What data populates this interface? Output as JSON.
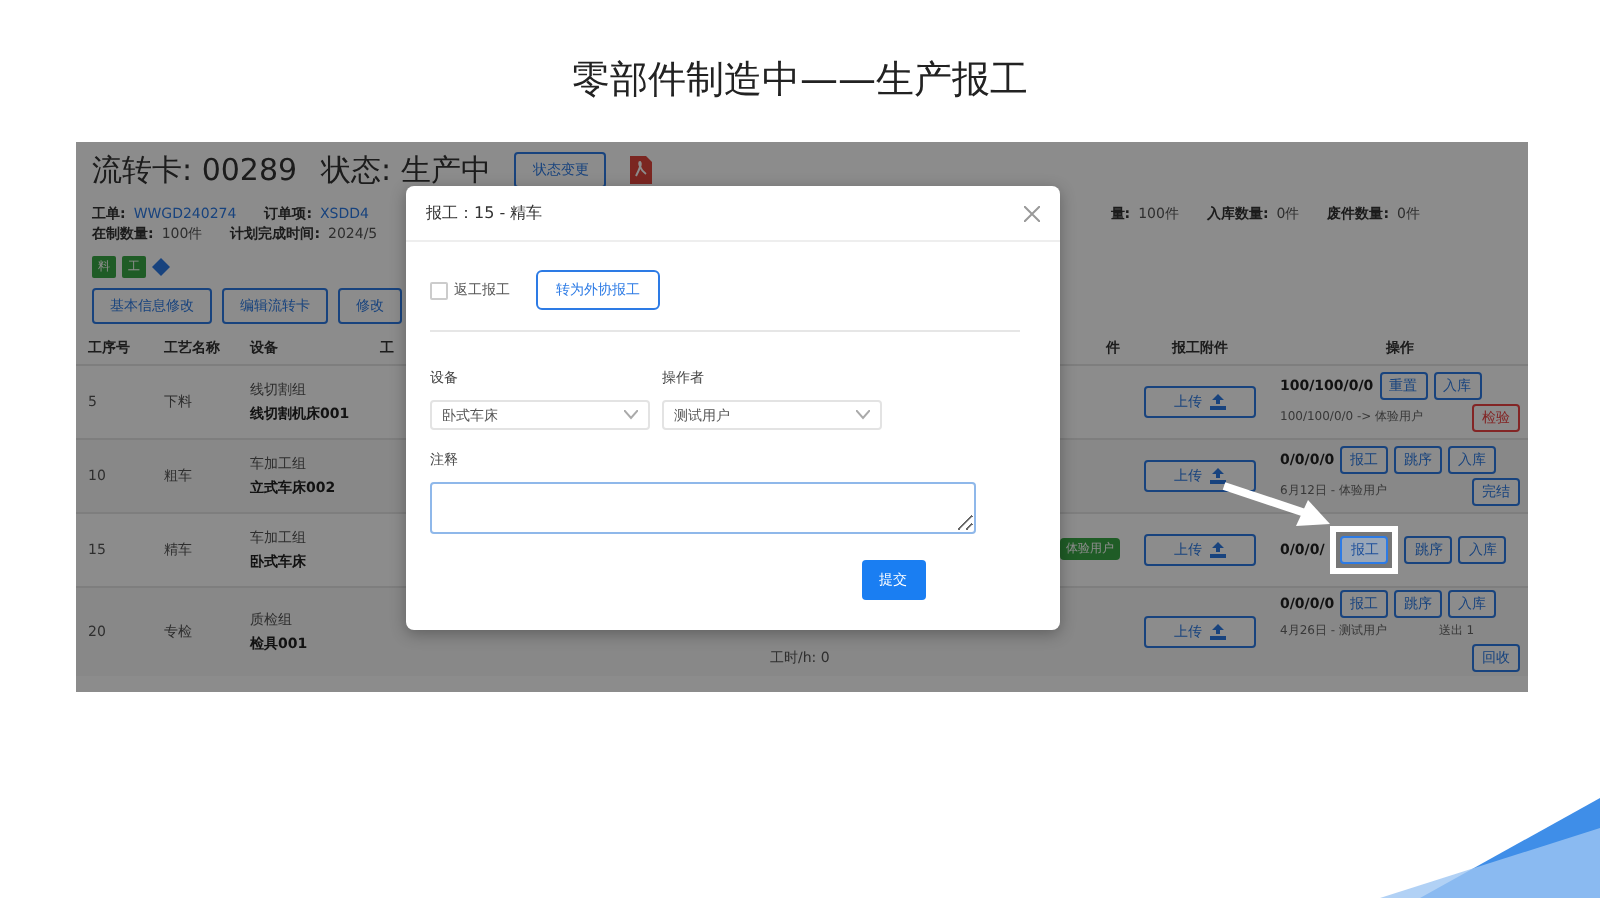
{
  "slide_title": "零部件制造中——生产报工",
  "screen": {
    "card_no": "流转卡: 00289",
    "status": "状态: 生产中",
    "status_button": "状态变更",
    "info_rows": [
      [
        {
          "label": "工单:",
          "value": "WWGD240274",
          "link": true
        },
        {
          "label": "订单项:",
          "value": "XSDD4",
          "link": true
        }
      ],
      [
        {
          "label": "在制数量:",
          "value": "100件",
          "link": false
        },
        {
          "label": "计划完成时间:",
          "value": "2024/5",
          "link": false
        }
      ]
    ],
    "info_right": [
      {
        "label": "量:",
        "value": "100件"
      },
      {
        "label": "入库数量:",
        "value": "0件"
      },
      {
        "label": "废件数量:",
        "value": "0件"
      }
    ],
    "tags": [
      "料",
      "工"
    ],
    "action_buttons": [
      "基本信息修改",
      "编辑流转卡",
      "修改"
    ],
    "columns": [
      "工序号",
      "工艺名称",
      "设备",
      "工",
      "件",
      "报工附件",
      "操作"
    ],
    "rows": [
      {
        "no": "5",
        "process": "下料",
        "group": "线切割组",
        "device": "线切割机床001",
        "hours": "",
        "worker_tag": "",
        "upload": "上传",
        "ops": [
          [
            {
              "kind": "count",
              "text": "100/100/0/0"
            },
            {
              "kind": "button",
              "text": "重置"
            },
            {
              "kind": "button",
              "text": "入库"
            }
          ],
          [
            {
              "kind": "note",
              "text": "100/100/0/0 -> 体验用户"
            },
            {
              "kind": "danger",
              "text": "检验"
            }
          ]
        ]
      },
      {
        "no": "10",
        "process": "粗车",
        "group": "车加工组",
        "device": "立式车床002",
        "hours": "",
        "worker_tag": "",
        "upload": "上传",
        "ops": [
          [
            {
              "kind": "count",
              "text": "0/0/0/0"
            },
            {
              "kind": "button",
              "text": "报工"
            },
            {
              "kind": "button",
              "text": "跳序"
            },
            {
              "kind": "button",
              "text": "入库"
            }
          ],
          [
            {
              "kind": "note",
              "text": "6月12日 - 体验用户"
            },
            {
              "kind": "button",
              "text": "完结"
            }
          ]
        ]
      },
      {
        "no": "15",
        "process": "精车",
        "group": "车加工组",
        "device": "卧式车床",
        "hours": "",
        "worker_tag": "体验用户",
        "upload": "上传",
        "ops": [
          [
            {
              "kind": "count",
              "text": "0/0/0/"
            },
            {
              "kind": "framed",
              "text": "报工"
            },
            {
              "kind": "button",
              "text": "跳序"
            },
            {
              "kind": "button",
              "text": "入库"
            }
          ]
        ]
      },
      {
        "no": "20",
        "process": "专检",
        "group": "质检组",
        "device": "检具001",
        "hours": "工时/h: 0",
        "worker_tag": "",
        "upload": "上传",
        "ops": [
          [
            {
              "kind": "count",
              "text": "0/0/0/0"
            },
            {
              "kind": "button",
              "text": "报工"
            },
            {
              "kind": "button",
              "text": "跳序"
            },
            {
              "kind": "button",
              "text": "入库"
            }
          ],
          [
            {
              "kind": "note",
              "text": "4月26日 - 测试用户"
            },
            {
              "kind": "note",
              "text": "送出 1"
            }
          ],
          [
            {
              "kind": "button",
              "text": "回收"
            }
          ]
        ]
      }
    ]
  },
  "dialog": {
    "title": "报工：15 - 精车",
    "rework": {
      "label": "返工报工",
      "checked": false
    },
    "outsource_button": "转为外协报工",
    "fields": [
      {
        "label": "设备",
        "value": "卧式车床"
      },
      {
        "label": "操作者",
        "value": "测试用户"
      }
    ],
    "note_label": "注释",
    "submit": "提交"
  }
}
